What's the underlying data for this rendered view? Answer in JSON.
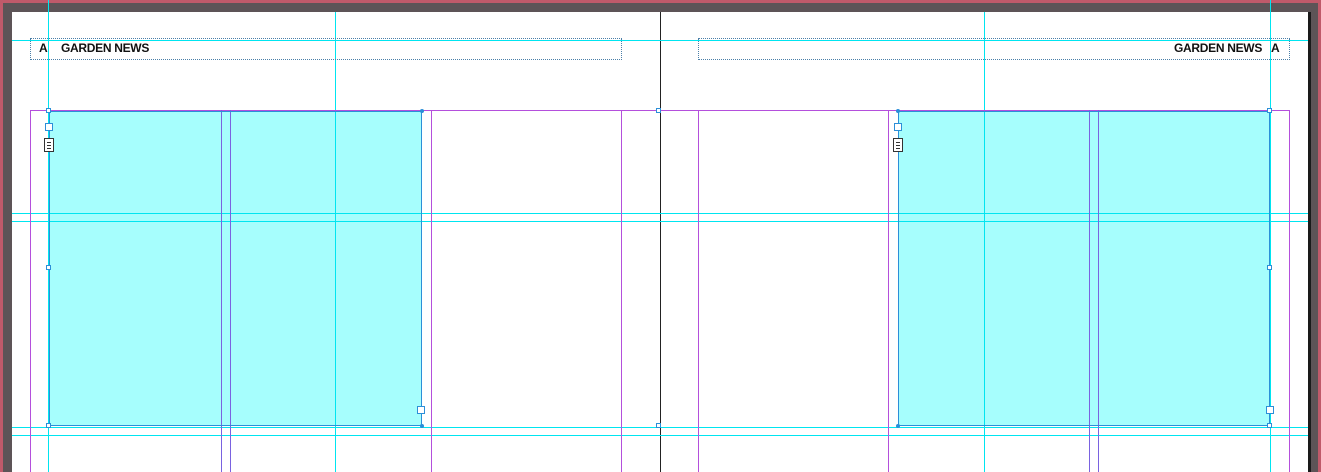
{
  "header": {
    "left_page_marker": "A",
    "left_title": "GARDEN NEWS",
    "right_title": "GARDEN NEWS",
    "right_page_marker": "A"
  },
  "colors": {
    "text_frame_fill": "#a6fefd",
    "guide": "#00e5f0",
    "margin": "#b44fdc",
    "column": "#7a62e0",
    "selection": "#2c8fd8"
  }
}
